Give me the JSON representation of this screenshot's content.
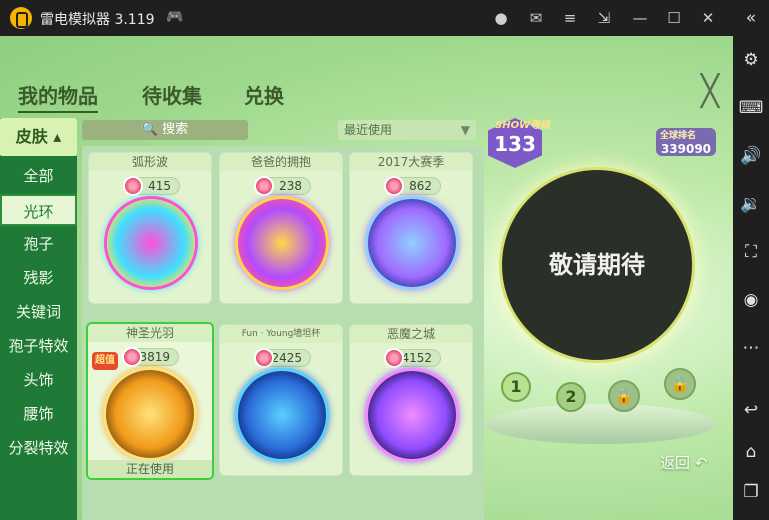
{
  "titlebar": {
    "title": "雷电模拟器 3.119",
    "icons": [
      "gamepad-icon",
      "avatar-icon",
      "mail-icon",
      "menu-icon",
      "popout-icon",
      "minimize-icon",
      "maximize-icon",
      "close-icon"
    ]
  },
  "toolbar": {
    "icons": [
      "collapse-icon",
      "settings-icon",
      "keyboard-icon",
      "volume-up-icon",
      "volume-down-icon",
      "screenshot-icon",
      "record-icon",
      "more-icon",
      "back-icon",
      "home-icon",
      "recent-apps-icon"
    ]
  },
  "game": {
    "tabs": [
      {
        "label": "我的物品",
        "active": true
      },
      {
        "label": "待收集",
        "active": false
      },
      {
        "label": "兑换",
        "active": false
      }
    ],
    "close_symbol": "╳",
    "categories": {
      "header": "皮肤",
      "items": [
        "全部",
        "光环",
        "孢子",
        "残影",
        "关键词",
        "孢子特效",
        "头饰",
        "腰饰",
        "分裂特效"
      ],
      "selected": "光环"
    },
    "search": {
      "placeholder": "搜索"
    },
    "filter": {
      "label": "最近使用"
    },
    "items": [
      {
        "name": "弧形波",
        "price": "415",
        "colors": [
          "#ff4fd8",
          "#3fe0ff",
          "#ffe24a"
        ]
      },
      {
        "name": "爸爸的拥抱",
        "price": "238",
        "colors": [
          "#ffd84a",
          "#b24cff",
          "#ff4fa0"
        ]
      },
      {
        "name": "2017大赛季",
        "price": "862",
        "colors": [
          "#8fd0ff",
          "#a06bff",
          "#2b3aa8"
        ]
      },
      {
        "name": "神圣光羽",
        "price": "3819",
        "colors": [
          "#ffe27a",
          "#f09a1a",
          "#7a4a10"
        ],
        "status": "正在使用",
        "badge": "超值"
      },
      {
        "name": "Fun · Young墙坦杯",
        "price": "2425",
        "colors": [
          "#5ad0ff",
          "#2a6bd8",
          "#0e2a7a"
        ]
      },
      {
        "name": "恶魔之城",
        "price": "4152",
        "colors": [
          "#f08cff",
          "#8f4cff",
          "#2a1a5a"
        ]
      }
    ],
    "preview": {
      "text": "敬请期待",
      "show_label": "SHOW等级",
      "show_level": "133",
      "rank_label": "全球排名",
      "rank": "339090"
    },
    "slots": [
      "1",
      "2"
    ],
    "back_label": "返回"
  },
  "colors": {
    "accent": "#1f7a38",
    "selected_border": "#3bcf3b",
    "tab_text": "#3b5a2a"
  }
}
